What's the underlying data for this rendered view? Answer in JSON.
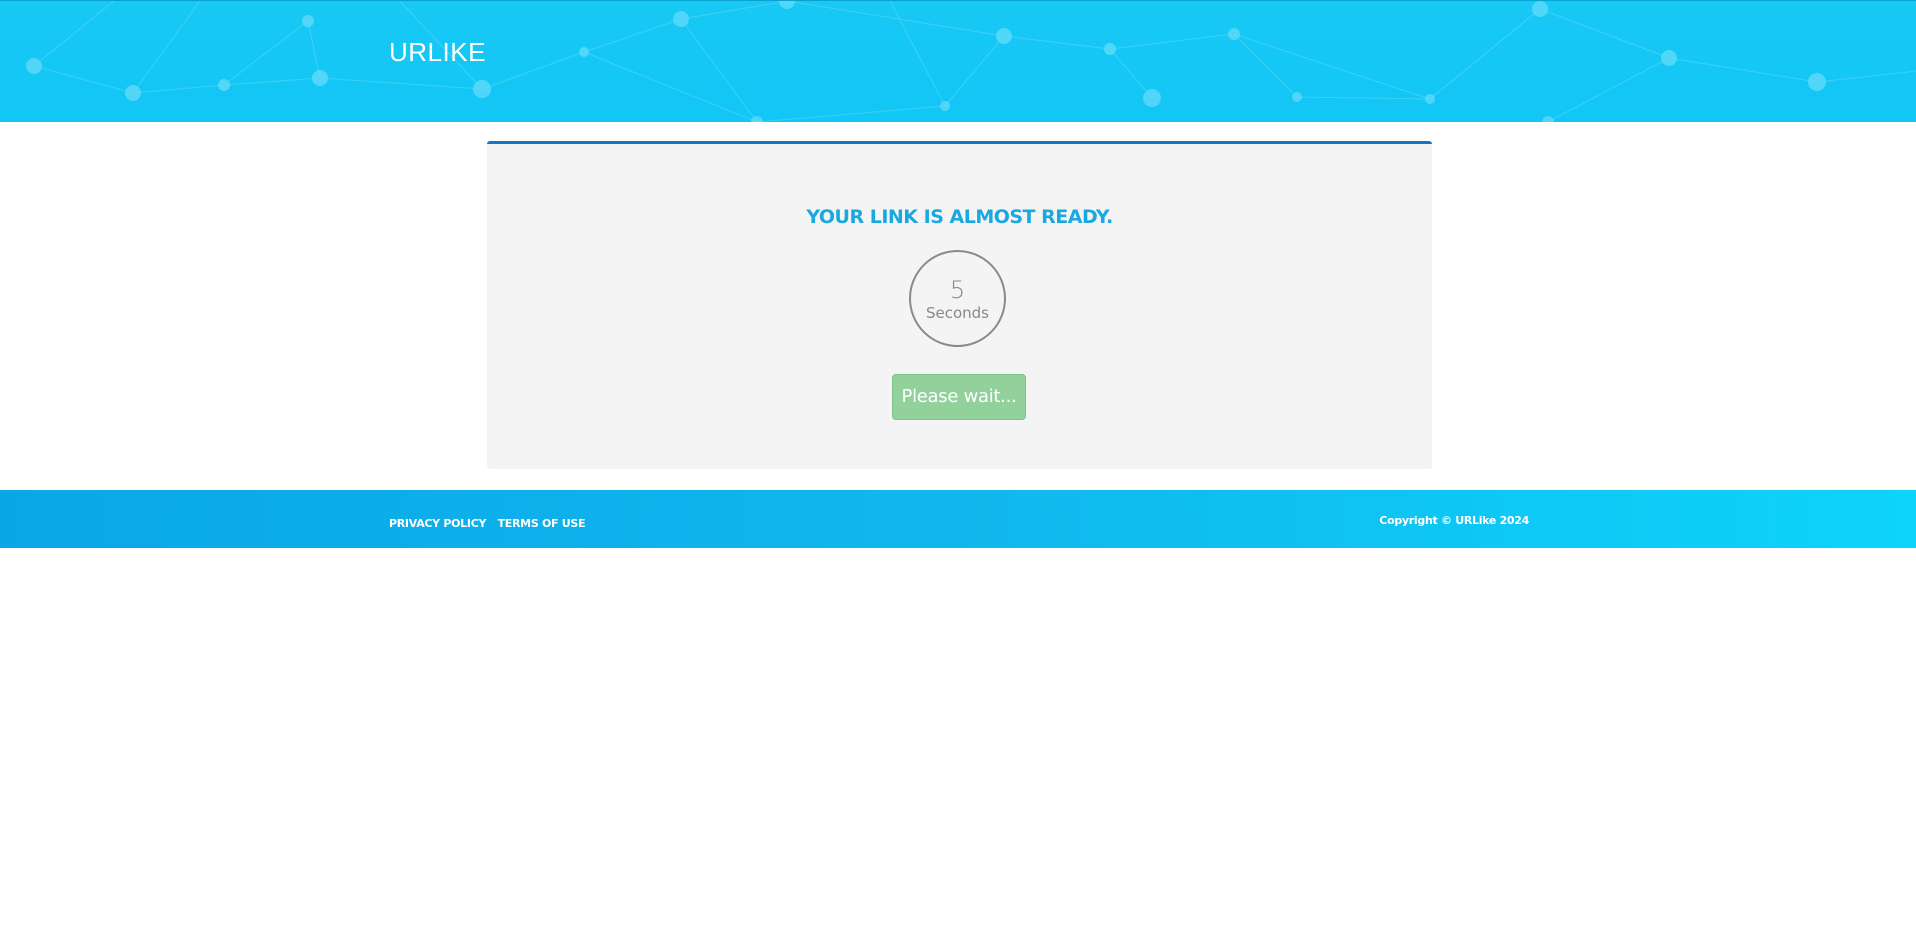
{
  "header": {
    "brand": "URLIKE"
  },
  "main": {
    "title": "YOUR LINK IS ALMOST READY.",
    "countdown": {
      "value": "5",
      "unit": "Seconds"
    },
    "wait_button_label": "Please wait..."
  },
  "footer": {
    "links": [
      {
        "label": "PRIVACY POLICY"
      },
      {
        "label": "TERMS OF USE"
      }
    ],
    "copyright": "Copyright © URLike 2024"
  },
  "colors": {
    "header_bg": "#12c6f5",
    "title": "#19a8e0",
    "panel_accent": "#1a73c2",
    "button": "#92d09c",
    "panel_bg": "#f4f4f4"
  }
}
